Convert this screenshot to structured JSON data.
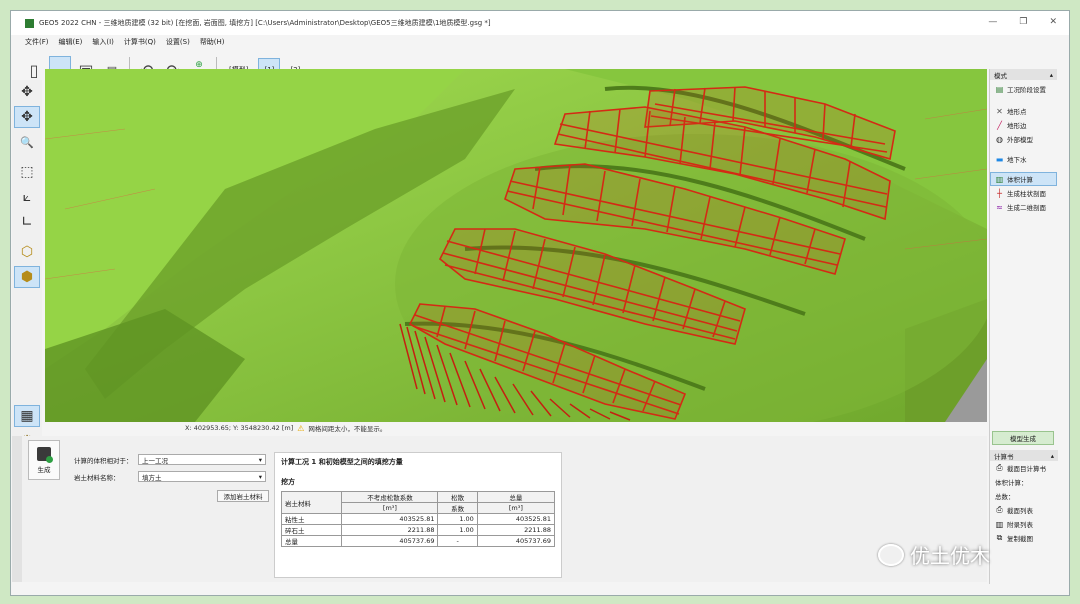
{
  "window": {
    "title": "GEO5 2022 CHN - 三维地质建模 (32 bit) [在挖面, 岩面图, 填挖方] [C:\\Users\\Administrator\\Desktop\\GEO5三维地质建模\\1地质模型.gsg *]",
    "minimize": "—",
    "restore": "❐",
    "close": "✕"
  },
  "menu": [
    "文件(F)",
    "编辑(E)",
    "输入(I)",
    "计算书(Q)",
    "设置(S)",
    "帮助(H)"
  ],
  "toolbar": {
    "tabs": [
      {
        "label": "[模型]",
        "active": false
      },
      {
        "label": "[1]",
        "active": true
      },
      {
        "label": "[2]",
        "active": false
      }
    ]
  },
  "left_tools": [
    {
      "icon": "move-icon",
      "glyph": "✥",
      "active": false
    },
    {
      "icon": "rotate-icon",
      "glyph": "✥",
      "active": true
    },
    {
      "icon": "zoom-icon",
      "glyph": "🔍",
      "active": false
    },
    {
      "icon": "zoom-window-icon",
      "glyph": "⬚",
      "active": false
    },
    {
      "icon": "axis-3d-icon",
      "glyph": "⟀",
      "active": false
    },
    {
      "icon": "axis-2d-icon",
      "glyph": "∟",
      "active": false
    },
    {
      "icon": "cube-wire-icon",
      "glyph": "⬡",
      "active": false
    },
    {
      "icon": "cube-solid-icon",
      "glyph": "⬢",
      "active": true
    }
  ],
  "bottom_tools": [
    {
      "icon": "table-icon",
      "glyph": "▦",
      "active": true
    },
    {
      "icon": "settings-icon",
      "glyph": "⚙",
      "active": false
    }
  ],
  "status": {
    "coords": "X: 402953.65; Y: 3548230.42 [m]",
    "warning": "网格间距太小，不能显示。"
  },
  "bottom_panel": {
    "generate_label": "生成",
    "volume_relative_label": "计算的体积相对于：",
    "volume_relative_value": "上一工况",
    "soil_name_label": "岩土材料名称：",
    "soil_name_value": "填方土",
    "add_soil_button": "添加岩土材料",
    "side_tab": "体积计算"
  },
  "result": {
    "title": "计算工况 1 和初始模型之间的填挖方量",
    "section": "挖方",
    "headers": {
      "material": "岩土材料",
      "no_loose": "不考虑松散系数",
      "no_loose_unit": "[m³]",
      "loose": "松散",
      "loose_unit": "系数",
      "total": "总量",
      "total_unit": "[m³]"
    },
    "rows": [
      {
        "material": "粘性土",
        "volume": "403525.81",
        "factor": "1.00",
        "total": "403525.81"
      },
      {
        "material": "碎石土",
        "volume": "2211.88",
        "factor": "1.00",
        "total": "2211.88"
      }
    ],
    "sum": {
      "label": "总量",
      "volume": "405737.69",
      "factor": "-",
      "total": "405737.69"
    }
  },
  "right_panel": {
    "header": "模式",
    "items": [
      {
        "label": "工况阶段设置",
        "icon": "stage-settings-icon",
        "glyph": "▤",
        "active": false
      },
      {
        "label": "地形点",
        "icon": "terrain-point-icon",
        "glyph": "✕",
        "active": false
      },
      {
        "label": "地形边",
        "icon": "terrain-edge-icon",
        "glyph": "╱",
        "active": false
      },
      {
        "label": "外部模型",
        "icon": "external-model-icon",
        "glyph": "◍",
        "active": false
      },
      {
        "label": "地下水",
        "icon": "groundwater-icon",
        "glyph": "▬",
        "active": false
      },
      {
        "label": "体积计算",
        "icon": "volume-calc-icon",
        "glyph": "▥",
        "active": true
      },
      {
        "label": "生成柱状剖面",
        "icon": "borehole-profile-icon",
        "glyph": "┼",
        "active": false
      },
      {
        "label": "生成二维剖面",
        "icon": "section-2d-icon",
        "glyph": "≈",
        "active": false
      }
    ],
    "model_generate": "模型生成",
    "calc_header": "计算书",
    "calc_items": [
      {
        "label": "截面目计算书",
        "glyph": "⎙"
      },
      {
        "label": "体积计算：",
        "glyph": ""
      },
      {
        "label": "总数：",
        "glyph": ""
      },
      {
        "label": "截面列表",
        "glyph": "⎙"
      },
      {
        "label": "附录列表",
        "glyph": "▥"
      },
      {
        "label": "复制截图",
        "glyph": "⧉"
      }
    ]
  },
  "watermark": "优土优木",
  "colors": {
    "terrain": "#8fcf3f",
    "terrain_dark": "#5d8f23",
    "grid_red": "#d42a14",
    "accent_blue": "#cde4f7"
  }
}
